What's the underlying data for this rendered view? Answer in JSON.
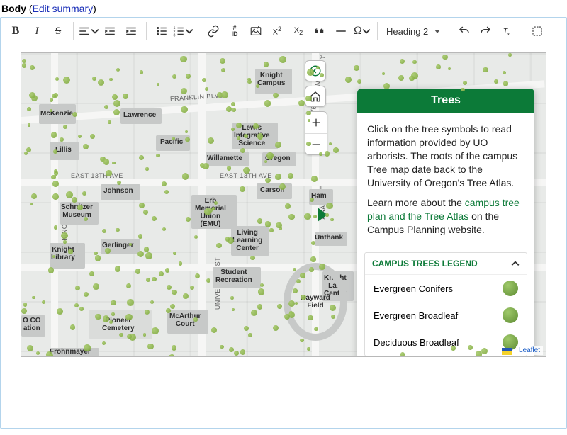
{
  "field": {
    "label": "Body",
    "edit_summary": "Edit summary"
  },
  "toolbar": {
    "heading_value": "Heading 2",
    "bold_glyph": "B",
    "italic_glyph": "I",
    "strike_glyph": "S",
    "hash_label_top": "#",
    "hash_label_bot": "ID",
    "sup_label": "X",
    "sub_label": "X",
    "quote_glyph": "“",
    "dash_glyph": "—",
    "omega_glyph": "Ω"
  },
  "map": {
    "streets": {
      "franklin": "FRANKLIN BLVD",
      "e13": "EAST 13TH AVE",
      "kincaid": "KINCAID ST",
      "university": "UNIVERSITY ST",
      "agate": "AGATE ST",
      "riverfront": "RIVERFRONT PKWY"
    },
    "buildings": {
      "mckenzie": "McKenzie",
      "lillis": "Lillis",
      "lawrence": "Lawrence",
      "pacific": "Pacific",
      "johnson": "Johnson",
      "schnitzer": "Schnitzer\nMuseum",
      "knightlib": "Knight\nLibrary",
      "gerlinger": "Gerlinger",
      "rec": "Student\nRecreation",
      "knightcampus": "Knight\nCampus",
      "lewis": "Lewis\nIntegrative\nScience",
      "willamette": "Willamette",
      "oregon": "Oregon",
      "carson": "Carson",
      "emu": "Erb\nMemorial\nUnion\n(EMU)",
      "living": "Living\nLearning\nCenter",
      "hayward": "Hayward\nField",
      "pioneer": "Pioneer\nCemetery",
      "mcarthur": "McArthur\nCourt",
      "frohnmayer": "Frohnmayer",
      "knightlaw": "Knight\nLaw\nCenter",
      "unthank": "Unthank",
      "hamilton": "Ham",
      "coed": "O CO\nation"
    },
    "panel": {
      "title": "Trees",
      "p1": "Click on the tree symbols to read information provided by UO arborists. The roots of the campus Tree map date back to the University of Oregon's Tree Atlas.",
      "p2_a": "Learn more about the ",
      "p2_link": "campus tree plan and the Tree Atlas",
      "p2_b": " on the Campus Planning website.",
      "legend_title": "CAMPUS TREES LEGEND",
      "legend": [
        "Evergreen Conifers",
        "Evergreen Broadleaf",
        "Deciduous Broadleaf"
      ]
    },
    "attribution": "Leaflet"
  }
}
